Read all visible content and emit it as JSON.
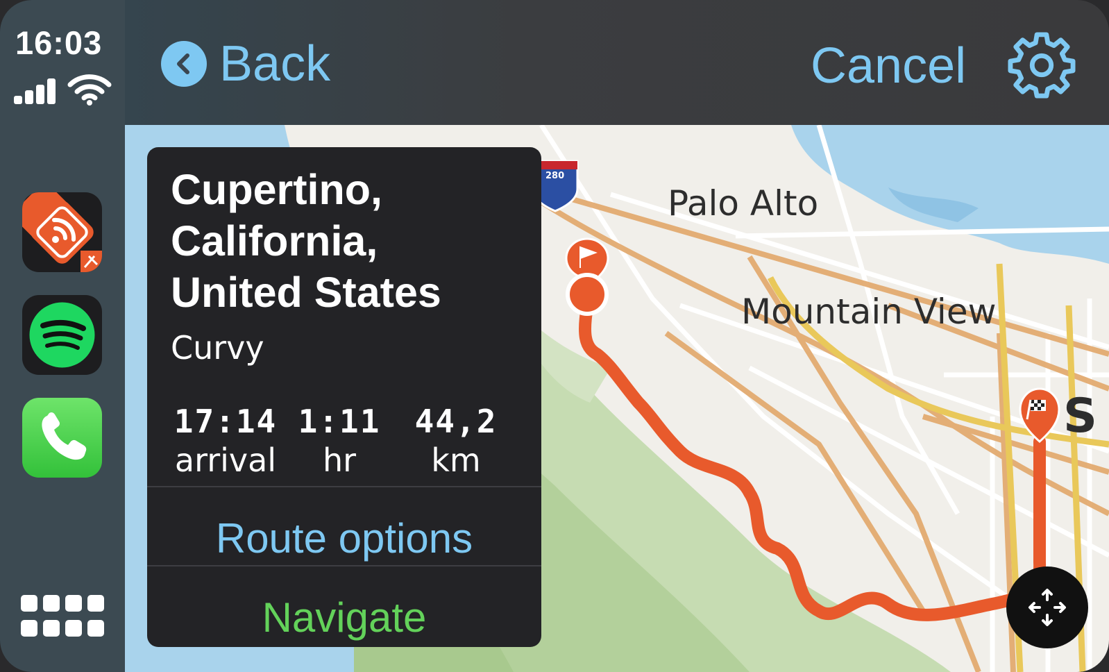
{
  "status": {
    "time": "16:03",
    "signal_bars": 4,
    "wifi": "wifi-icon"
  },
  "dock": {
    "apps": [
      {
        "name": "route-app",
        "icon": "route-diamond-icon"
      },
      {
        "name": "spotify",
        "icon": "spotify-icon"
      },
      {
        "name": "phone",
        "icon": "phone-icon"
      }
    ],
    "grid_icon": "app-grid-icon"
  },
  "header": {
    "back_label": "Back",
    "cancel_label": "Cancel",
    "settings_icon": "gear-icon"
  },
  "map": {
    "labels": {
      "palo_alto": "Palo Alto",
      "mountain_view": "Mountain View",
      "partial_city": "S",
      "highway": "280"
    },
    "route_color": "#e85a2c",
    "water_color": "#a9d3ec",
    "park_color": "#b9d4a1"
  },
  "card": {
    "title_lines": [
      "Cupertino,",
      "California,",
      "United States"
    ],
    "route_type": "Curvy",
    "stats": {
      "arrival_value": "17:14",
      "arrival_unit": "arrival",
      "duration_value": "1:11",
      "duration_unit": "hr",
      "distance_value": "44,2",
      "distance_unit": "km"
    },
    "route_options_label": "Route options",
    "navigate_label": "Navigate"
  },
  "colors": {
    "accent_blue": "#7ec8f2",
    "accent_green": "#63d25a",
    "card_bg": "#232326"
  }
}
